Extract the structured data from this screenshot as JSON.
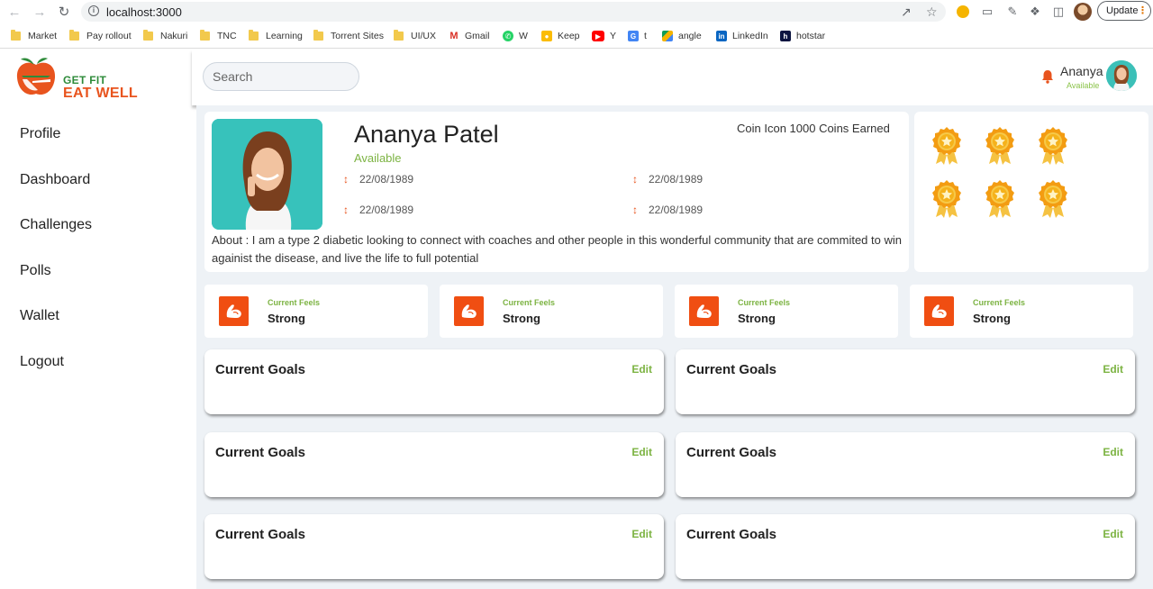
{
  "browser": {
    "url": "localhost:3000",
    "update_label": "Update",
    "bookmarks": [
      {
        "label": "Market",
        "icon": "folder-icon"
      },
      {
        "label": "Pay rollout",
        "icon": "folder-icon"
      },
      {
        "label": "Nakuri",
        "icon": "folder-icon"
      },
      {
        "label": "TNC",
        "icon": "folder-icon"
      },
      {
        "label": "Learning",
        "icon": "folder-icon"
      },
      {
        "label": "Torrent Sites",
        "icon": "folder-icon"
      },
      {
        "label": "UI/UX",
        "icon": "folder-icon"
      },
      {
        "label": "Gmail",
        "icon": "gmail-icon"
      },
      {
        "label": "W",
        "icon": "whatsapp-icon"
      },
      {
        "label": "Keep",
        "icon": "keep-icon"
      },
      {
        "label": "Y",
        "icon": "youtube-icon"
      },
      {
        "label": "t",
        "icon": "translate-icon"
      },
      {
        "label": "angle",
        "icon": "drive-icon"
      },
      {
        "label": "LinkedIn",
        "icon": "linkedin-icon"
      },
      {
        "label": "hotstar",
        "icon": "hotstar-icon"
      }
    ]
  },
  "brand": {
    "line1": "GET FIT",
    "line2": "EAT WELL"
  },
  "nav": [
    "Profile",
    "Dashboard",
    "Challenges",
    "Polls",
    "Wallet",
    "Logout"
  ],
  "search": {
    "placeholder": "Search"
  },
  "user": {
    "name": "Ananya",
    "status": "Available"
  },
  "profile": {
    "name": "Ananya Patel",
    "status": "Available",
    "coins": "Coin Icon 1000 Coins Earned",
    "fields": [
      "22/08/1989",
      "22/08/1989",
      "22/08/1989",
      "22/08/1989"
    ],
    "about": "About : I am a type 2 diabetic looking to connect with coaches and other people in this wonderful community that are commited to win againist the disease, and live the life to full potential"
  },
  "medals_count": 6,
  "feels": [
    {
      "label": "Current Feels",
      "value": "Strong"
    },
    {
      "label": "Current Feels",
      "value": "Strong"
    },
    {
      "label": "Current Feels",
      "value": "Strong"
    },
    {
      "label": "Current Feels",
      "value": "Strong"
    }
  ],
  "goals": [
    {
      "title": "Current Goals",
      "edit": "Edit"
    },
    {
      "title": "Current Goals",
      "edit": "Edit"
    },
    {
      "title": "Current Goals",
      "edit": "Edit"
    },
    {
      "title": "Current Goals",
      "edit": "Edit"
    },
    {
      "title": "Current Goals",
      "edit": "Edit"
    },
    {
      "title": "Current Goals",
      "edit": "Edit"
    }
  ],
  "colors": {
    "brand_orange": "#e8541e",
    "brand_green": "#2e8b3a",
    "accent_green": "#7cb342",
    "feel_icon_bg": "#f04e12",
    "main_bg": "#eef2f6"
  }
}
